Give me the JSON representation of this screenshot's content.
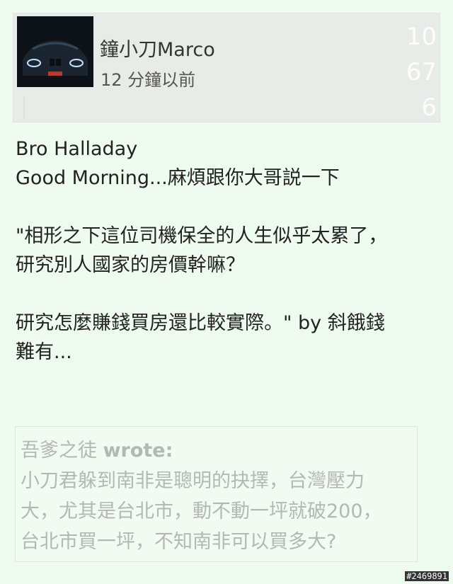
{
  "post": {
    "author": "鐘小刀Marco",
    "timestamp": "12 分鐘以前",
    "counts": [
      "10",
      "67",
      "6"
    ]
  },
  "message": {
    "lines": [
      "Bro Halladay",
      "Good Morning...麻煩跟你大哥説一下",
      "",
      "\"相形之下這位司機保全的人生似乎太累了，",
      "研究別人國家的房價幹嘛？",
      "",
      "研究怎麼賺錢買房還比較實際。\" by 斜餓錢",
      "難有..."
    ]
  },
  "quote": {
    "author": "吾爹之徒",
    "wrote_label": "wrote:",
    "lines": [
      "小刀君躲到南非是聰明的抉擇，台灣壓力",
      "大，尤其是台北市，動不動一坪就破200，",
      "台北市買一坪，不知南非可以買多大?"
    ]
  },
  "watermark": "#2469891"
}
